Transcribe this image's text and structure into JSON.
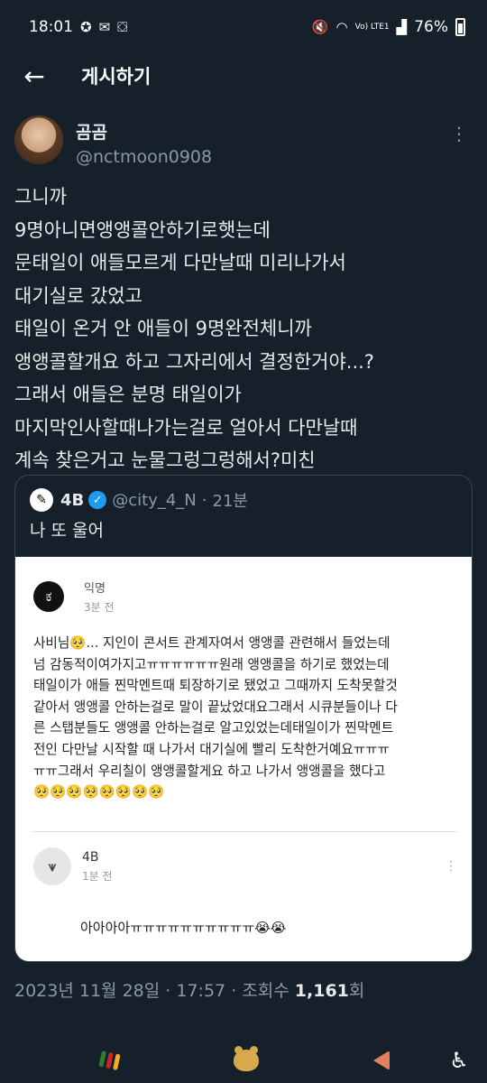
{
  "status_bar": {
    "time": "18:01",
    "battery": "76%",
    "network_label": "Vo) LTE1",
    "notification_icons": [
      "game-icon",
      "gmail-icon",
      "shopping-bag-icon"
    ],
    "system_icons": [
      "mute-icon",
      "wifi-icon",
      "signal-icon",
      "battery-icon"
    ]
  },
  "header": {
    "title": "게시하기",
    "back_icon": "←"
  },
  "tweet": {
    "display_name": "곰곰",
    "handle": "@nctmoon0908",
    "more_icon": "⋮",
    "text": "그니까\n9명아니면앵앵콜안하기로햇는데\n문태일이 애들모르게 다만날때 미리나가서\n대기실로 갔었고\n태일이 온거 안 애들이 9명완전체니까\n앵앵콜할개요 하고 그자리에서 결정한거야...?\n그래서 애들은 분명 태일이가\n마지막인사할때나가는걸로 얼아서 다만날때\n계속 찾은거고 눈물그렁그렁해서?미친",
    "date": "2023년 11월 28일",
    "separator": "·",
    "time": "17:57",
    "views_label": "조회수",
    "views_count": "1,161",
    "views_suffix": "회"
  },
  "quote": {
    "name": "4B",
    "verified_icon": "✓",
    "handle": "@city_4_N",
    "separator": "·",
    "age": "21분",
    "text": "나 또 울어",
    "logo_icon": "✎"
  },
  "quoted_image": {
    "author_name": "익명",
    "author_time": "3분 전",
    "body": "사비님🥺... 지인이 콘서트 관계자여서 앵앵콜 관련해서 들었는데\n넘 감동적이여가지고ㅠㅠㅠㅠㅠㅠ원래 앵앵콜을 하기로 했었는데\n태일이가 애들 찐막멘트때 퇴장하기로 됐었고 그때까지 도착못할것\n같아서 앵앵콜 안하는걸로 말이 끝났었대요그래서 시큐분들이나 다\n른 스탭분들도 앵앵콜 안하는걸로 알고있었는데태일이가 찐막멘트\n전인 다만날 시작할 때 나가서 대기실에 빨리 도착한거예요ㅠㅠㅠ\nㅠㅠ그래서 우리칠이 앵앵콜할게요 하고 나가서 앵앵콜을 했다고\n🥺🥺🥺🥺🥺🥺🥺🥺",
    "comment_author": "4B",
    "comment_time": "1분 전",
    "comment_text": "아아아아ㅠㅠㅠㅠㅠㅠㅠㅠㅠㅠ😭😭",
    "comment_more": "⋮"
  },
  "nav_bar": {
    "items": [
      "apps-icon",
      "bear-icon",
      "back-icon",
      "accessibility-icon"
    ],
    "accessibility_glyph": "♿",
    "colors": {
      "apps_bars": [
        "#2e7d32",
        "#c62828",
        "#f9a825"
      ],
      "bear": "#d7a94c",
      "back": "#e0805f"
    }
  },
  "colors": {
    "background": "#15202b",
    "text_primary": "#e7e9ea",
    "text_secondary": "#8b98a5",
    "verified": "#1d9bf0",
    "border": "#38444d"
  }
}
